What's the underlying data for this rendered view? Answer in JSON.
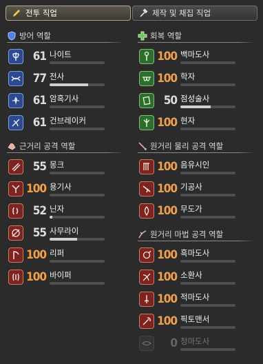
{
  "tabs": [
    {
      "label": "전투 직업",
      "active": true,
      "icon": "pen-icon"
    },
    {
      "label": "제작 및 채집 직업",
      "active": false,
      "icon": "hammer-icon"
    }
  ],
  "sections": {
    "tank": {
      "title": "방어 역할",
      "icon": "shield-icon",
      "jobs": [
        {
          "name": "나이트",
          "level": "61",
          "progress": 0
        },
        {
          "name": "전사",
          "level": "77",
          "progress": 0.7
        },
        {
          "name": "암흑기사",
          "level": "61",
          "progress": 0
        },
        {
          "name": "건브레이커",
          "level": "61",
          "progress": 0
        }
      ]
    },
    "healer": {
      "title": "회복 역할",
      "icon": "healer-cross-icon",
      "jobs": [
        {
          "name": "백마도사",
          "level": "100",
          "progress": 0
        },
        {
          "name": "학자",
          "level": "100",
          "progress": 0
        },
        {
          "name": "점성술사",
          "level": "50",
          "progress": 0.55
        },
        {
          "name": "현자",
          "level": "100",
          "progress": 0
        }
      ]
    },
    "melee": {
      "title": "근거리 공격 역할",
      "icon": "melee-fist-icon",
      "jobs": [
        {
          "name": "몽크",
          "level": "55",
          "progress": 0
        },
        {
          "name": "용기사",
          "level": "100",
          "progress": 0
        },
        {
          "name": "닌자",
          "level": "52",
          "progress": 0.05
        },
        {
          "name": "사무라이",
          "level": "55",
          "progress": 0.5
        },
        {
          "name": "리퍼",
          "level": "100",
          "progress": 0
        },
        {
          "name": "바이퍼",
          "level": "100",
          "progress": 0
        }
      ]
    },
    "ranged_physical": {
      "title": "원거리 물리 공격 역할",
      "icon": "bow-arrow-icon",
      "jobs": [
        {
          "name": "음유시인",
          "level": "100",
          "progress": 0
        },
        {
          "name": "기공사",
          "level": "100",
          "progress": 0
        },
        {
          "name": "무도가",
          "level": "100",
          "progress": 0
        }
      ]
    },
    "ranged_magic": {
      "title": "원거리 마법 공격 역할",
      "icon": "magic-wand-icon",
      "jobs": [
        {
          "name": "흑마도사",
          "level": "100",
          "progress": 0
        },
        {
          "name": "소환사",
          "level": "100",
          "progress": 0
        },
        {
          "name": "적마도사",
          "level": "100",
          "progress": 0
        },
        {
          "name": "픽토맨서",
          "level": "100",
          "progress": 0
        },
        {
          "name": "청마도사",
          "level": "0",
          "progress": 0
        }
      ]
    }
  },
  "colors": {
    "max_level": "#f0a04b",
    "tank": "#2d4a8f",
    "healer": "#2f6c32",
    "dps": "#7a2424"
  }
}
